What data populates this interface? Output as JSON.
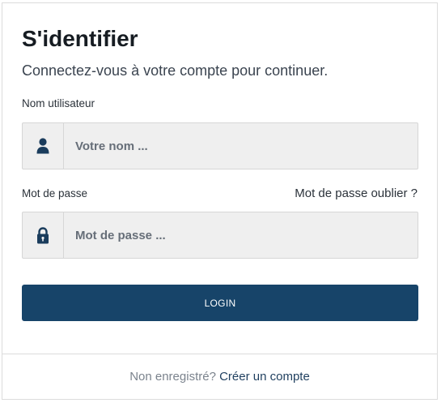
{
  "form": {
    "title": "S'identifier",
    "subtitle": "Connectez-vous à votre compte pour continuer.",
    "username": {
      "label": "Nom utilisateur",
      "placeholder": "Votre nom ...",
      "icon": "user-icon"
    },
    "password": {
      "label": "Mot de passe",
      "placeholder": "Mot de passe ...",
      "icon": "lock-icon",
      "forgot_link": "Mot de passe oublier ?"
    },
    "login_label": "LOGIN",
    "footer": {
      "prompt": "Non enregistré?",
      "signup_link": "Créer un compte"
    }
  },
  "colors": {
    "primary": "#174469",
    "field_bg": "#efefef",
    "icon": "#1a3c5c"
  }
}
